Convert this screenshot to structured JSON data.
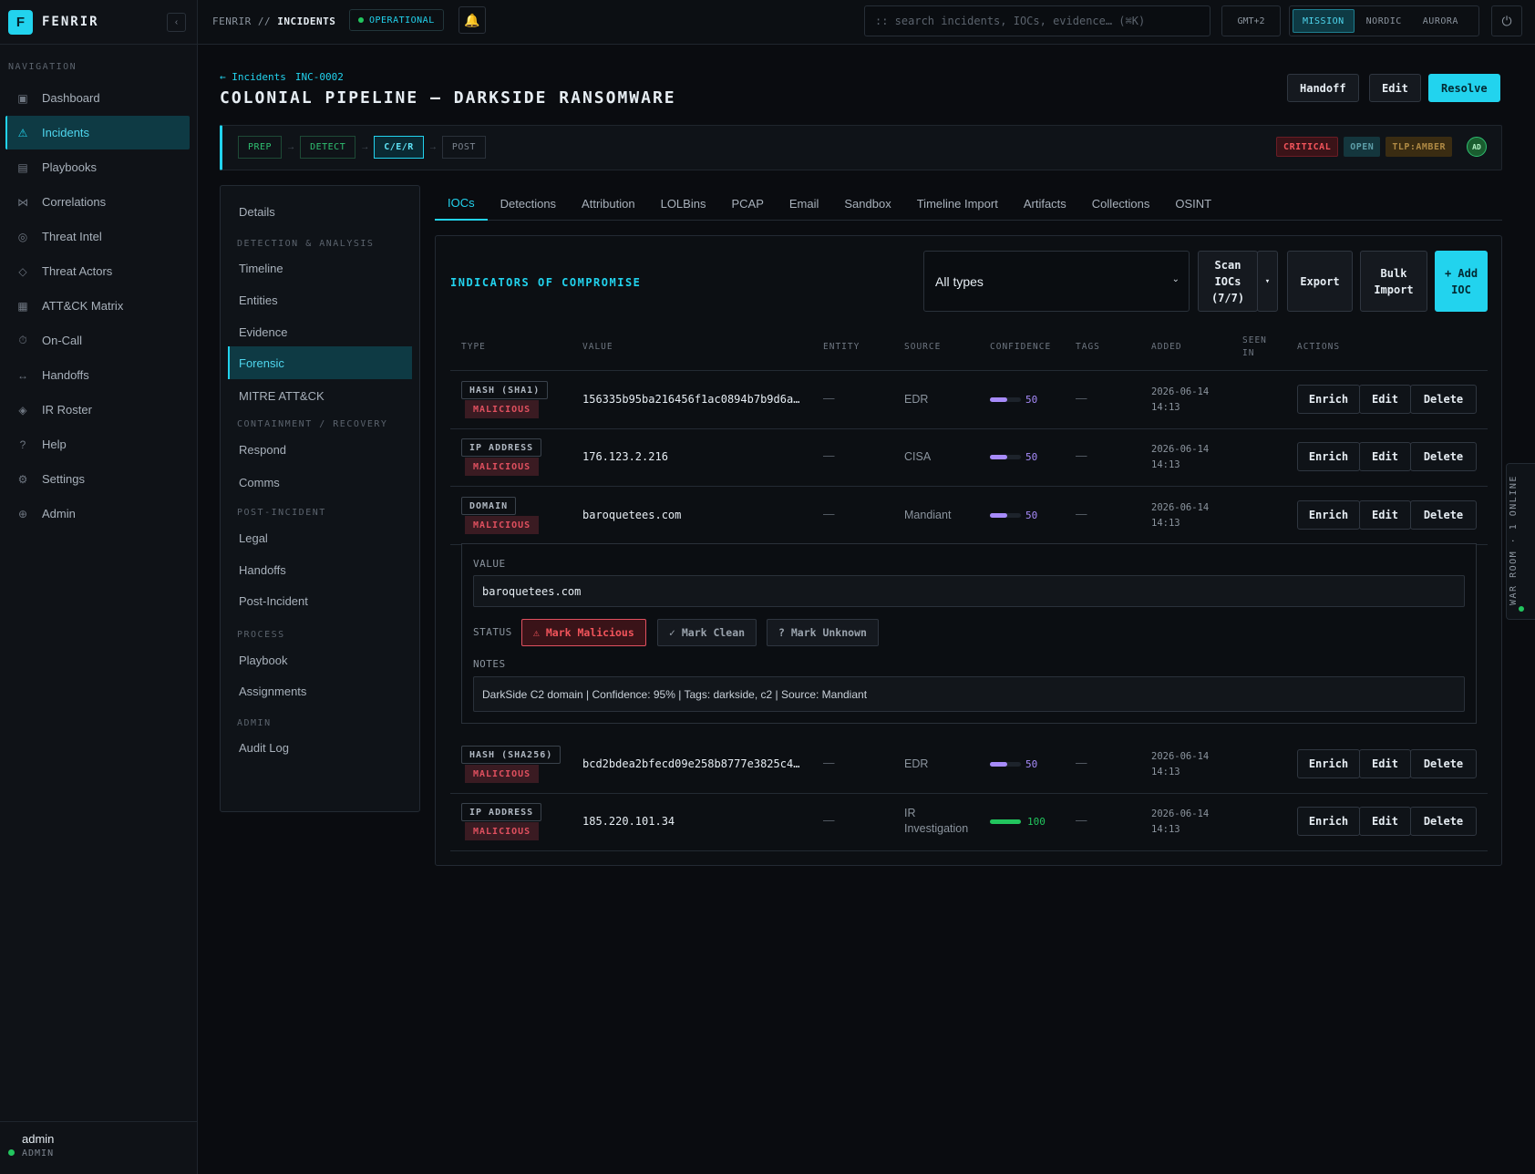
{
  "brand": {
    "logo_letter": "F",
    "name": "FENRIR",
    "collapse_icon": "‹"
  },
  "sidebar": {
    "section_label": "NAVIGATION",
    "items": [
      {
        "label": "Dashboard",
        "icon": "▣",
        "icon_name": "dashboard-icon"
      },
      {
        "label": "Incidents",
        "icon": "⚠",
        "icon_name": "warning-icon",
        "active": true
      },
      {
        "label": "Playbooks",
        "icon": "▤",
        "icon_name": "playbook-icon"
      },
      {
        "label": "Correlations",
        "icon": "⋈",
        "icon_name": "correlation-icon"
      },
      {
        "label": "Threat Intel",
        "icon": "◎",
        "icon_name": "target-icon"
      },
      {
        "label": "Threat Actors",
        "icon": "◇",
        "icon_name": "actor-icon"
      },
      {
        "label": "ATT&CK Matrix",
        "icon": "▦",
        "icon_name": "matrix-icon"
      },
      {
        "label": "On-Call",
        "icon": "⏱",
        "icon_name": "clock-icon"
      },
      {
        "label": "Handoffs",
        "icon": "↔",
        "icon_name": "handoff-icon"
      },
      {
        "label": "IR Roster",
        "icon": "◈",
        "icon_name": "roster-icon"
      },
      {
        "label": "Help",
        "icon": "?",
        "icon_name": "help-icon"
      },
      {
        "label": "Settings",
        "icon": "⚙",
        "icon_name": "gear-icon"
      },
      {
        "label": "Admin",
        "icon": "⊕",
        "icon_name": "admin-icon"
      }
    ],
    "user": {
      "name": "admin",
      "role": "ADMIN"
    }
  },
  "topbar": {
    "breadcrumb_root": "FENRIR //",
    "breadcrumb_current": "INCIDENTS",
    "status": "OPERATIONAL",
    "bell_icon": "🔔",
    "search_placeholder": ":: search incidents, IOCs, evidence… (⌘K)",
    "timezone": "GMT+2",
    "themes": [
      "MISSION",
      "NORDIC",
      "AURORA"
    ],
    "active_theme": "MISSION",
    "power_icon": "⏻"
  },
  "incident": {
    "back_label": "← Incidents",
    "id": "INC-0002",
    "title": "COLONIAL PIPELINE — DARKSIDE RANSOMWARE",
    "actions": {
      "handoff": "Handoff",
      "edit": "Edit",
      "resolve": "Resolve"
    },
    "phases": [
      "PREP",
      "DETECT",
      "C/E/R",
      "POST"
    ],
    "phase_arrow": "→",
    "current_phase": "C/E/R",
    "severity": "CRITICAL",
    "state": "OPEN",
    "tlp": "TLP:AMBER",
    "assignee_initials": "AD"
  },
  "subnav": {
    "details": "Details",
    "sections": [
      {
        "heading": "DETECTION & ANALYSIS",
        "items": [
          "Timeline",
          "Entities",
          "Evidence",
          "Forensic",
          "MITRE ATT&CK"
        ]
      },
      {
        "heading": "CONTAINMENT / RECOVERY",
        "items": [
          "Respond",
          "Comms"
        ]
      },
      {
        "heading": "POST-INCIDENT",
        "items": [
          "Legal",
          "Handoffs",
          "Post-Incident"
        ]
      },
      {
        "heading": "PROCESS",
        "items": [
          "Playbook",
          "Assignments"
        ]
      },
      {
        "heading": "ADMIN",
        "items": [
          "Audit Log"
        ]
      }
    ],
    "active": "Forensic"
  },
  "tabs": [
    "IOCs",
    "Detections",
    "Attribution",
    "LOLBins",
    "PCAP",
    "Email",
    "Sandbox",
    "Timeline Import",
    "Artifacts",
    "Collections",
    "OSINT"
  ],
  "active_tab": "IOCs",
  "ioc_panel": {
    "title": "INDICATORS OF COMPROMISE",
    "type_filter": "All types",
    "scan_label": "Scan IOCs (7/7)",
    "scan_dropdown": "▾",
    "export_label": "Export",
    "bulk_import_label": "Bulk Import",
    "add_label": "+ Add IOC",
    "columns": [
      "TYPE",
      "VALUE",
      "ENTITY",
      "SOURCE",
      "CONFIDENCE",
      "TAGS",
      "ADDED",
      "SEEN IN",
      "ACTIONS"
    ],
    "rows": [
      {
        "type": "HASH (SHA1)",
        "verdict": "MALICIOUS",
        "value": "156335b95ba216456f1ac0894b7b9d6a…",
        "entity": "—",
        "source": "EDR",
        "confidence": 50,
        "tags": "—",
        "added": "2026-06-14\n14:13"
      },
      {
        "type": "IP ADDRESS",
        "verdict": "MALICIOUS",
        "value": "176.123.2.216",
        "entity": "—",
        "source": "CISA",
        "confidence": 50,
        "tags": "—",
        "added": "2026-06-14\n14:13"
      },
      {
        "type": "DOMAIN",
        "verdict": "MALICIOUS",
        "value": "baroquetees.com",
        "entity": "—",
        "source": "Mandiant",
        "confidence": 50,
        "tags": "—",
        "added": "2026-06-14\n14:13"
      },
      {
        "type": "HASH (SHA256)",
        "verdict": "MALICIOUS",
        "value": "bcd2bdea2bfecd09e258b8777e3825c4…",
        "entity": "—",
        "source": "EDR",
        "confidence": 50,
        "tags": "—",
        "added": "2026-06-14\n14:13"
      },
      {
        "type": "IP ADDRESS",
        "verdict": "MALICIOUS",
        "value": "185.220.101.34",
        "entity": "—",
        "source": "IR Investigation",
        "confidence": 100,
        "tags": "—",
        "added": "2026-06-14\n14:13"
      }
    ],
    "row_actions": {
      "enrich": "Enrich",
      "edit": "Edit",
      "delete": "Delete"
    },
    "editor": {
      "value_label": "VALUE",
      "value": "baroquetees.com",
      "status_label": "STATUS",
      "mark_malicious": "⚠ Mark Malicious",
      "mark_clean": "✓ Mark Clean",
      "mark_unknown": "? Mark Unknown",
      "notes_label": "NOTES",
      "notes": "DarkSide C2 domain | Confidence: 95% | Tags: darkside, c2 | Source: Mandiant"
    }
  },
  "war_room": {
    "label": "WAR ROOM · 1 ONLINE"
  },
  "colors": {
    "accent": "#22d3ee",
    "critical": "#f2545b",
    "confidence_mid": "#a78bfa",
    "confidence_high": "#22c55e"
  }
}
